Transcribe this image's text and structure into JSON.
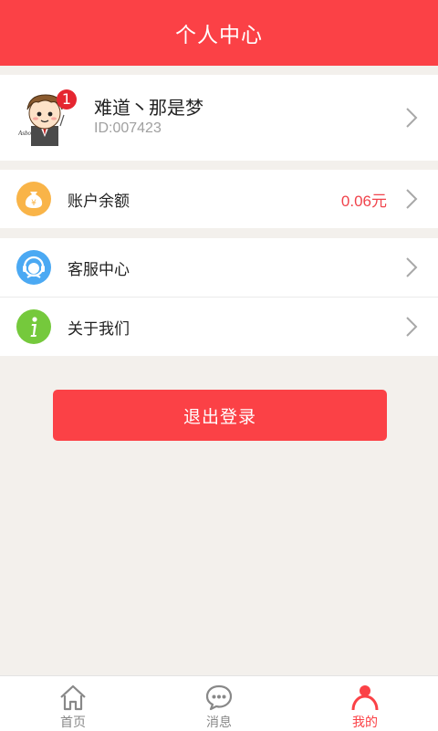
{
  "header": {
    "title": "个人中心"
  },
  "profile": {
    "username": "难道丶那是梦",
    "user_id": "ID:007423",
    "badge_count": "1",
    "avatar_icon": "cartoon-avatar-icon"
  },
  "menu": {
    "balance_label": "账户余额",
    "balance_value": "0.06元",
    "service_label": "客服中心",
    "about_label": "关于我们"
  },
  "logout": {
    "label": "退出登录"
  },
  "tabbar": {
    "tabs": [
      {
        "label": "首页",
        "icon": "home-icon"
      },
      {
        "label": "消息",
        "icon": "message-icon"
      },
      {
        "label": "我的",
        "icon": "user-icon"
      }
    ],
    "active_index": 2
  },
  "colors": {
    "brand": "#fb4146",
    "balance_icon": "#f9b448",
    "service_icon": "#4ba9f3",
    "about_icon": "#75c93c",
    "background": "#f3f0ec"
  }
}
